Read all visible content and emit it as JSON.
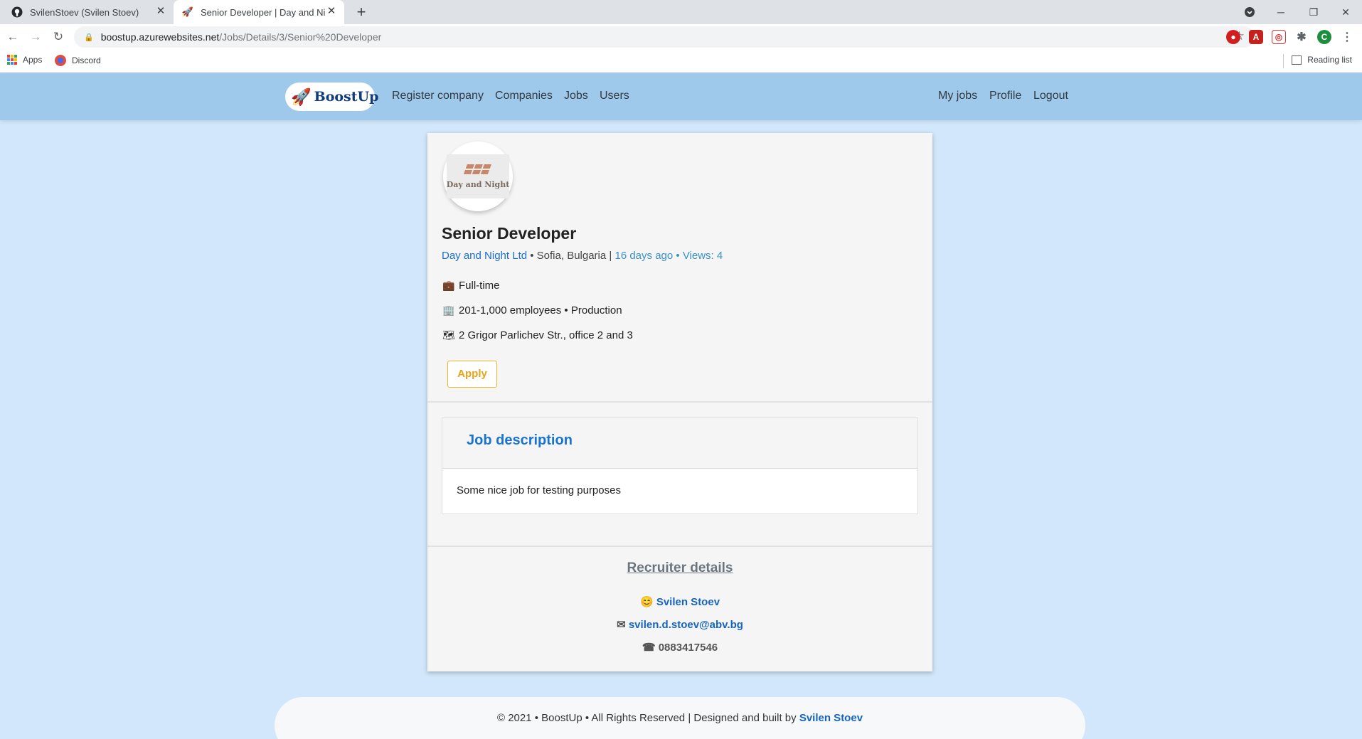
{
  "browser": {
    "tabs": [
      {
        "title": "SvilenStoev (Svilen Stoev)",
        "favicon": "github-icon"
      },
      {
        "title": "Senior Developer | Day and Night Ltd",
        "favicon": "rocket-icon"
      }
    ],
    "new_tab": "+",
    "url_host": "boostup.azurewebsites.net",
    "url_path": "/Jobs/Details/3/Senior%20Developer",
    "profile_initial": "C",
    "bookmarks": [
      {
        "label": "Apps",
        "icon": "apps-grid-icon"
      },
      {
        "label": "Discord",
        "icon": "discord-icon"
      }
    ],
    "reading_list": "Reading list"
  },
  "site": {
    "brand": "BoostUp",
    "nav_left": [
      "Register company",
      "Companies",
      "Jobs",
      "Users"
    ],
    "nav_right": [
      "My jobs",
      "Profile",
      "Logout"
    ]
  },
  "job": {
    "logo_text": "Day and Night",
    "title": "Senior Developer",
    "company": "Day and Night Ltd",
    "location": "Sofia, Bulgaria",
    "posted": "16 days ago",
    "views": "Views: 4",
    "employment_type": "Full-time",
    "company_size_sector": "201-1,000 employees • Production",
    "address": "2 Grigor Parlichev Str., office 2 and 3",
    "apply_label": "Apply"
  },
  "description": {
    "heading": "Job description",
    "body": "Some nice job for testing purposes"
  },
  "recruiter": {
    "heading": "Recruiter details",
    "name": "Svilen Stoev",
    "email": "svilen.d.stoev@abv.bg",
    "phone": "0883417546"
  },
  "footer": {
    "text": "© 2021 • BoostUp • All Rights Reserved | Designed and built by",
    "author": "Svilen Stoev"
  },
  "colors": {
    "page_bg": "#d2e7fb",
    "navbar_bg": "#9ec9eb",
    "link_blue": "#1a73d0",
    "apply_accent": "#f0b429"
  }
}
